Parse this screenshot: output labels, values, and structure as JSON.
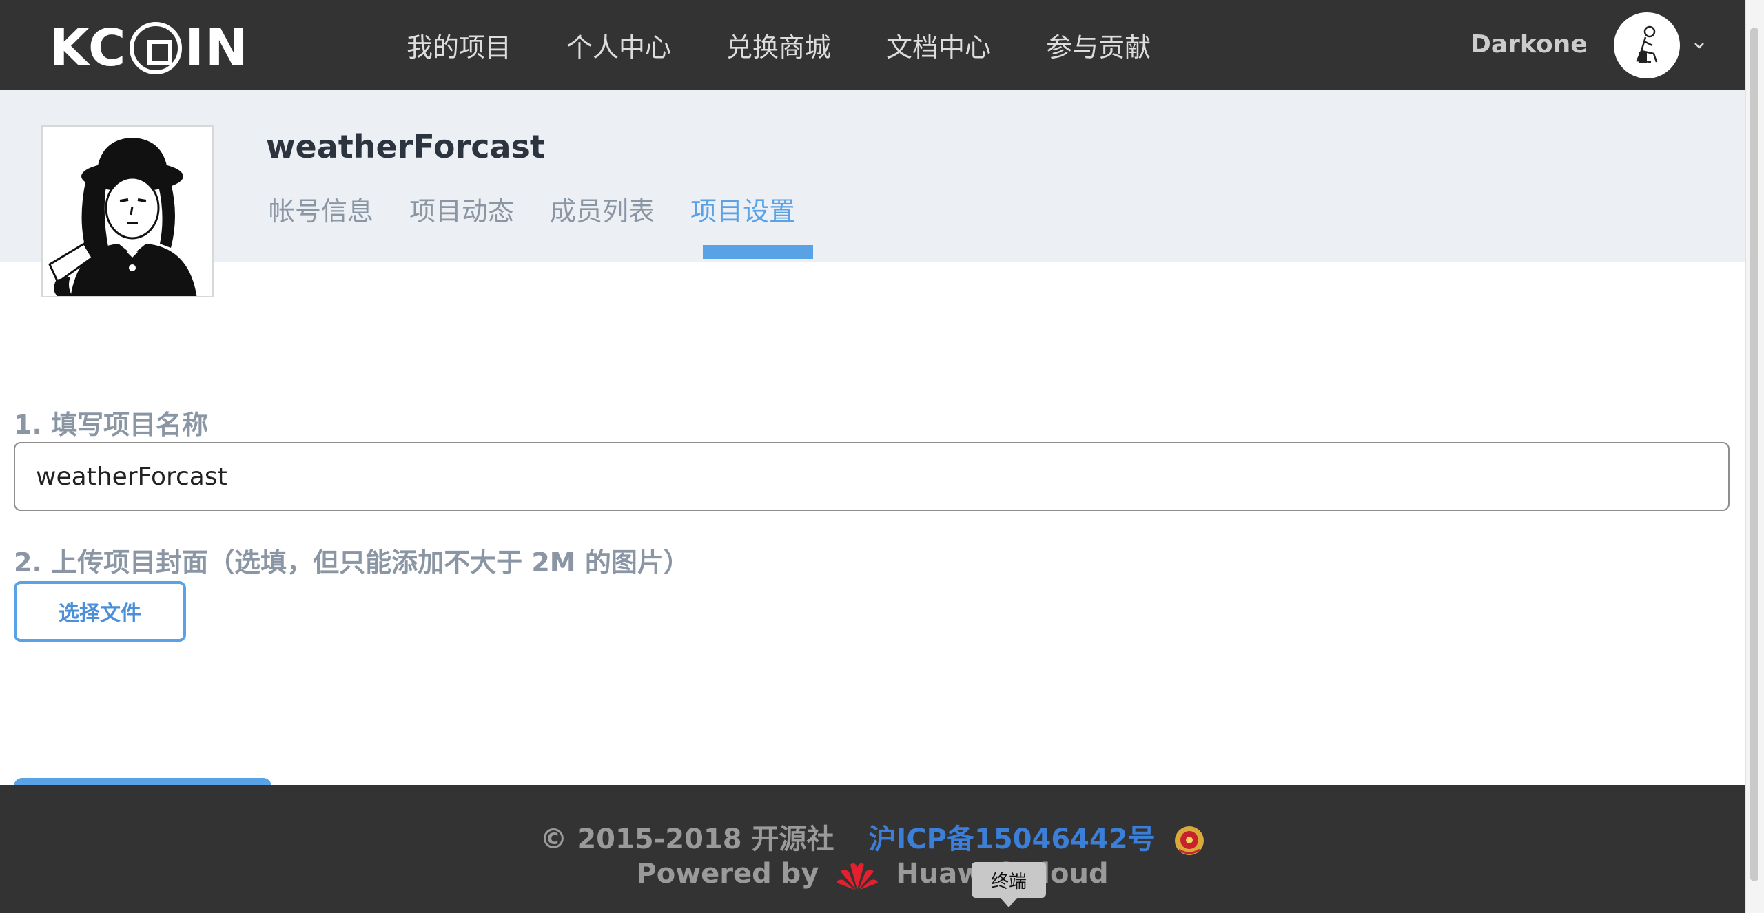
{
  "brand": {
    "logo_text_left": "KC",
    "logo_text_right": "IN"
  },
  "nav": {
    "items": [
      "我的项目",
      "个人中心",
      "兑换商城",
      "文档中心",
      "参与贡献"
    ]
  },
  "user": {
    "name": "Darkone"
  },
  "project": {
    "title": "weatherForcast",
    "tabs": [
      "帐号信息",
      "项目动态",
      "成员列表",
      "项目设置"
    ],
    "active_tab": "项目设置"
  },
  "form": {
    "name_label": "1. 填写项目名称",
    "name_value": "weatherForcast",
    "cover_label": "2. 上传项目封面（选填，但只能添加不大于 2M 的图片）",
    "file_button_label": "选择文件"
  },
  "footer": {
    "copyright": "© 2015-2018 开源社",
    "icp": "沪ICP备15046442号",
    "powered_prefix": "Powered by",
    "powered_name": "Huawei Cloud"
  },
  "tooltip": {
    "text": "终端"
  },
  "colors": {
    "topbar": "#333333",
    "accent": "#5aa2e6",
    "band": "#eceff4",
    "icp_link": "#3b7fd9"
  }
}
